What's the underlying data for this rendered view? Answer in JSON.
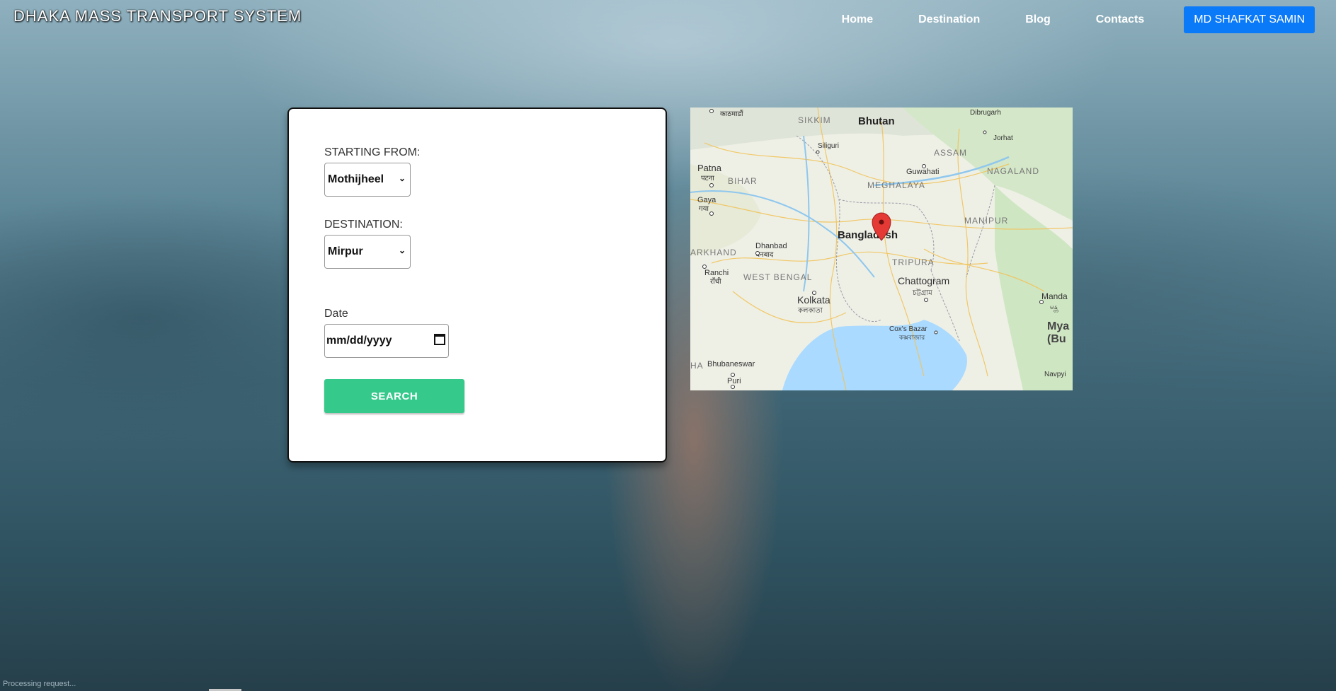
{
  "brand": {
    "title": "DHAKA MASS TRANSPORT SYSTEM"
  },
  "nav": {
    "items": [
      "Home",
      "Destination",
      "Blog",
      "Contacts"
    ],
    "user_button": "MD SHAFKAT SAMIN",
    "user_button_color": "#0b7af8"
  },
  "form": {
    "starting_label": "STARTING FROM:",
    "starting_value": "Mothijheel",
    "destination_label": "DESTINATION:",
    "destination_value": "Mirpur",
    "date_label": "Date",
    "date_placeholder": "mm/dd/yyyy",
    "search_label": "SEARCH",
    "search_color": "#35c98c"
  },
  "map": {
    "labels": {
      "bhutan": "Bhutan",
      "sikkim": "SIKKIM",
      "assam": "ASSAM",
      "nagaland": "NAGALAND",
      "meghalaya": "MEGHALAYA",
      "guwahati": "Guwahati",
      "dibrugarh": "Dibrugarh",
      "jorhat": "Jorhat",
      "siliguri": "Siliguri",
      "patna": "Patna",
      "patna_native": "पटना",
      "bihar": "BIHAR",
      "gaya": "Gaya",
      "gaya_native": "गया",
      "bangladesh": "Bangladesh",
      "manipur": "MANIPUR",
      "dhanbad": "Dhanbad",
      "dhanbad_native": "धनबाद",
      "jharkhand": "ARKHAND",
      "ranchi": "Ranchi",
      "ranchi_native": "राँची",
      "west_bengal": "WEST BENGAL",
      "tripura": "TRIPURA",
      "chattogram": "Chattogram",
      "chattogram_native": "চট্টগ্রাম",
      "kolkata": "Kolkata",
      "kolkata_native": "কলকাতা",
      "mandalay": "Manda",
      "mandalay_native": "မန္တ",
      "myanmar": "Mya",
      "burma": "(Bu",
      "coxs_bazar": "Cox's Bazar",
      "coxs_bazar_native": "কক্সবাজার",
      "bhubaneswar": "Bhubaneswar",
      "odisha": "HA",
      "puri": "Puri",
      "navpyi": "Navpyi",
      "kathmandu_native": "काठमाडौं"
    },
    "marker_color": "#e53935"
  },
  "status": {
    "text": "Processing request..."
  }
}
